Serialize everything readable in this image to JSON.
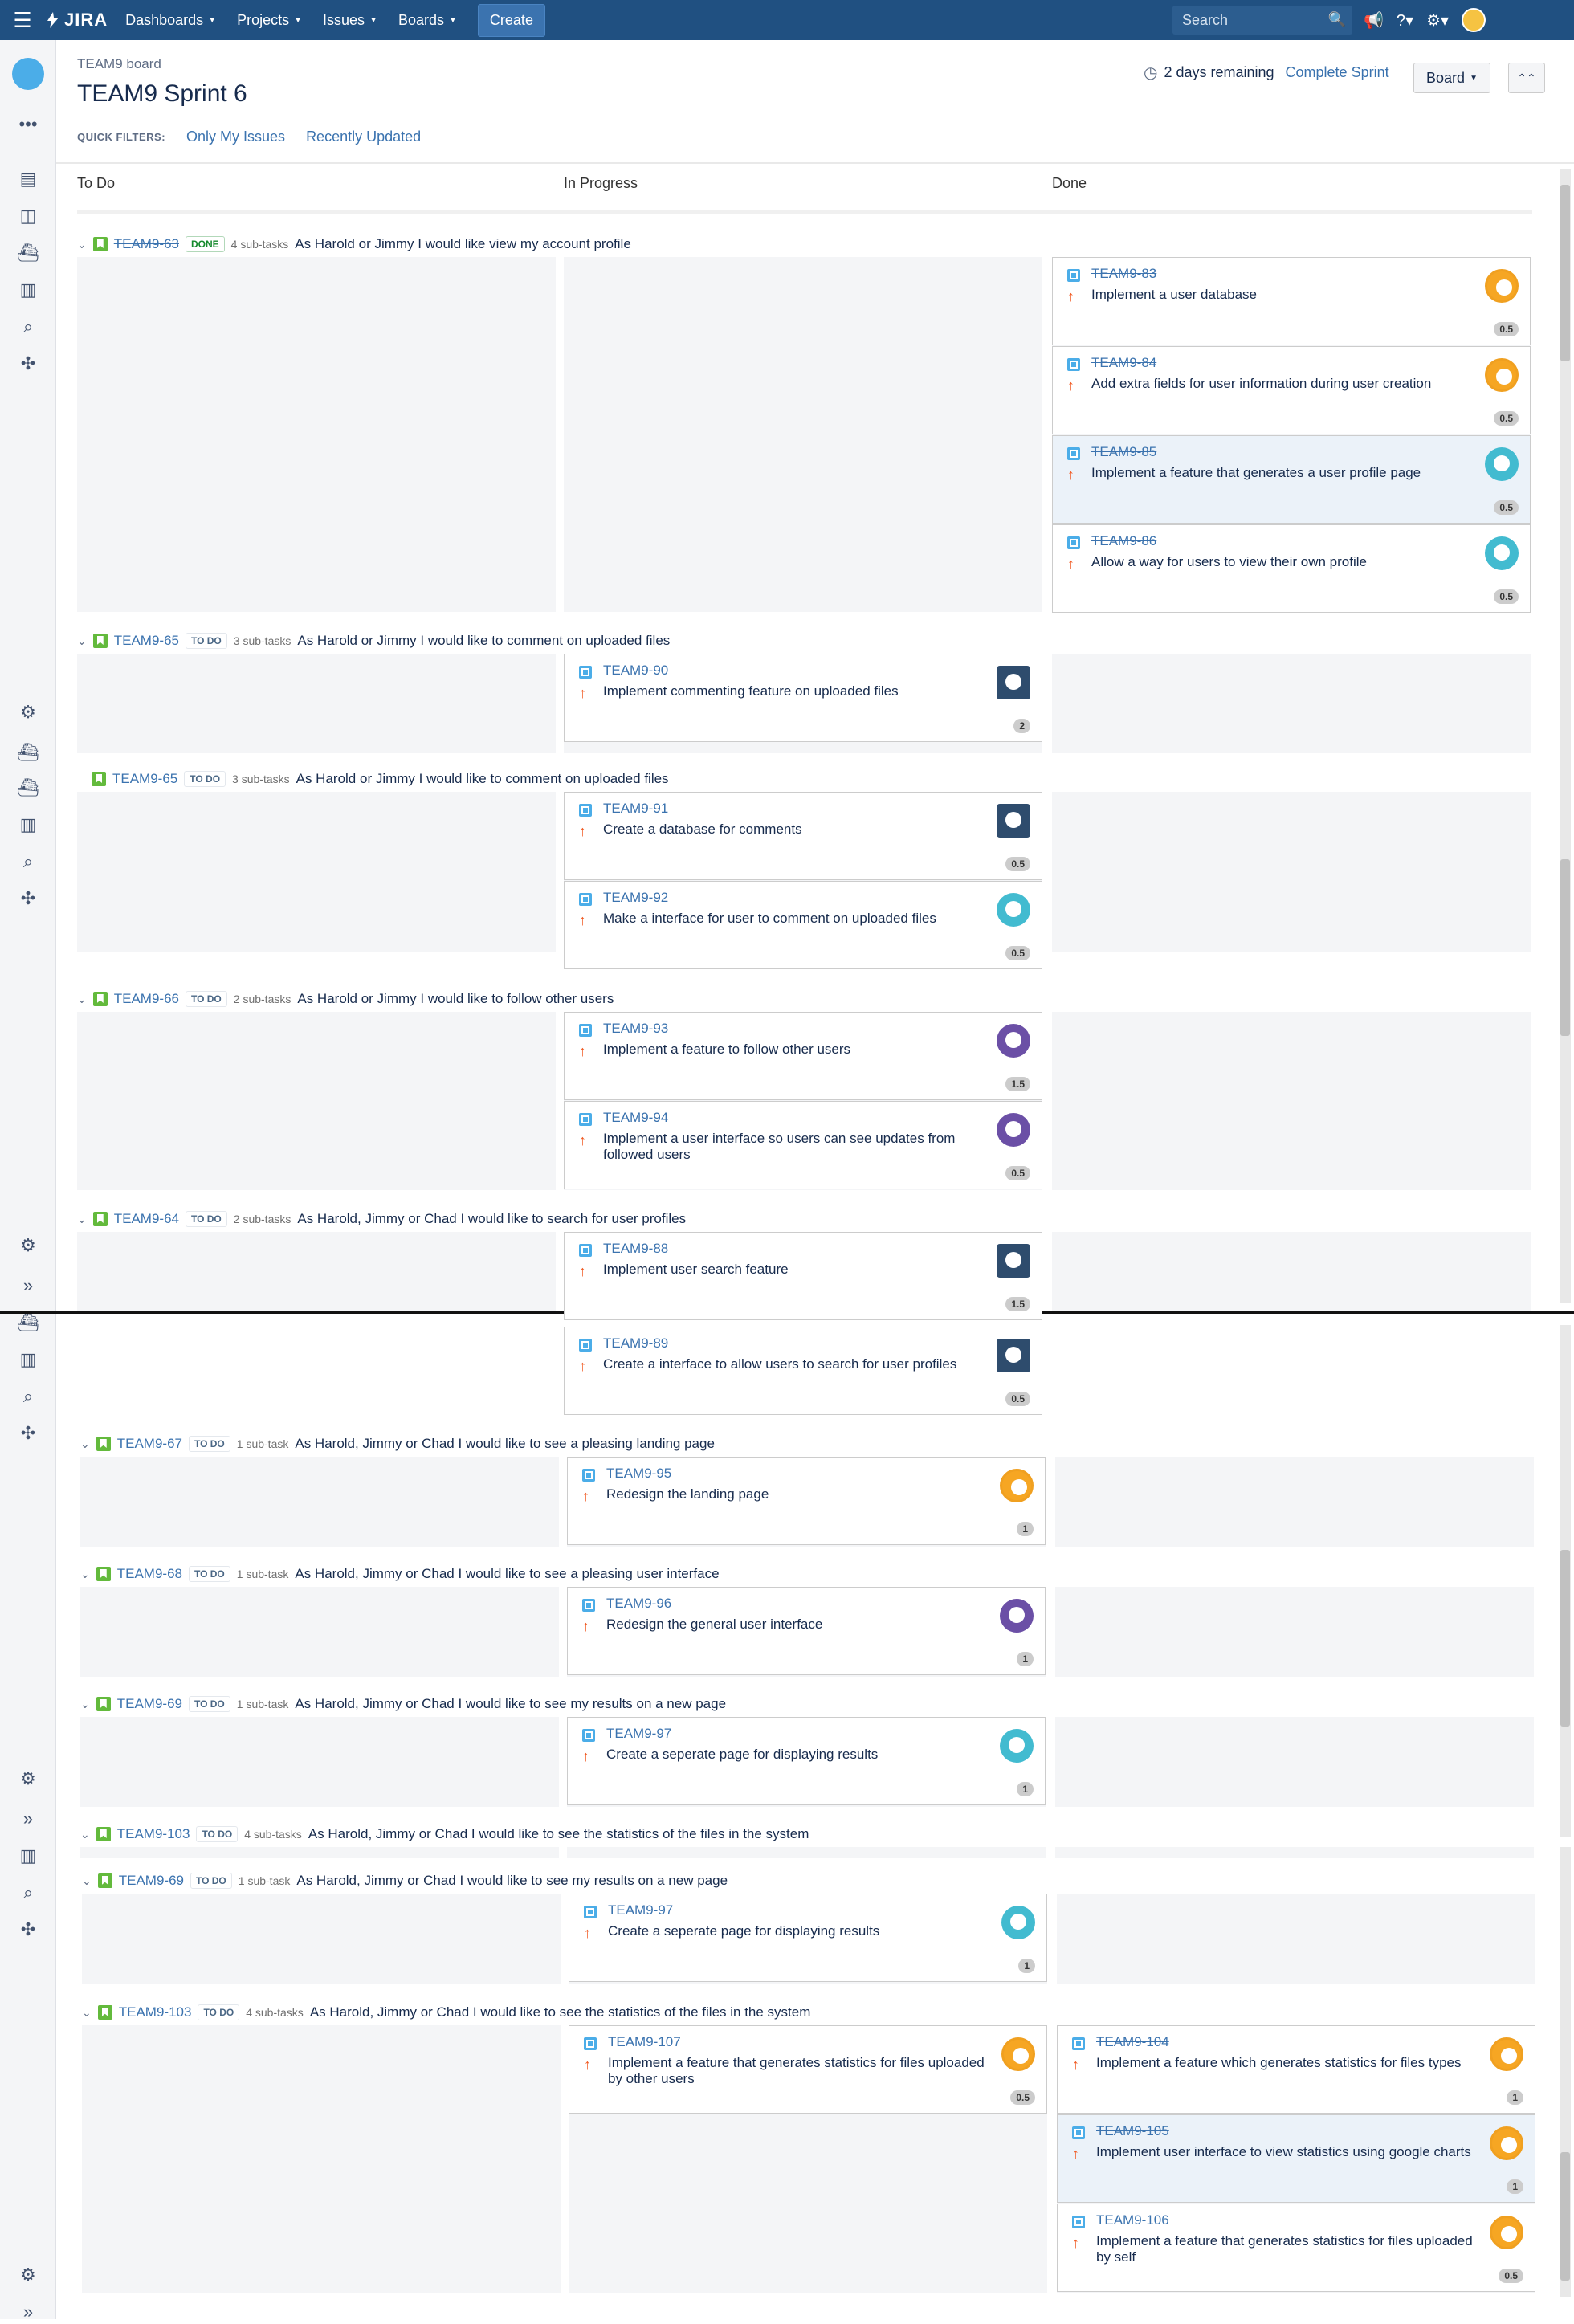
{
  "nav": {
    "items": [
      "Dashboards",
      "Projects",
      "Issues",
      "Boards"
    ],
    "create": "Create",
    "search_placeholder": "Search",
    "logo": "JIRA"
  },
  "header": {
    "board_name": "TEAM9 board",
    "sprint_name": "TEAM9 Sprint 6",
    "remaining": "2 days remaining",
    "complete": "Complete Sprint",
    "board_btn": "Board"
  },
  "quick_filters": {
    "label": "QUICK FILTERS:",
    "f1": "Only My Issues",
    "f2": "Recently Updated"
  },
  "columns": [
    "To Do",
    "In Progress",
    "Done"
  ],
  "swimlanes": [
    {
      "key": "TEAM9-63",
      "status": "DONE",
      "subtasks": "4 sub-tasks",
      "summary": "As Harold or Jimmy I would like view my account profile"
    },
    {
      "key": "TEAM9-65",
      "status": "TO DO",
      "subtasks": "3 sub-tasks",
      "summary": "As Harold or Jimmy I would like to comment on uploaded files"
    },
    {
      "key": "TEAM9-65",
      "status": "TO DO",
      "subtasks": "3 sub-tasks",
      "summary": "As Harold or Jimmy I would like to comment on uploaded files"
    },
    {
      "key": "TEAM9-66",
      "status": "TO DO",
      "subtasks": "2 sub-tasks",
      "summary": "As Harold or Jimmy I would like to follow other users"
    },
    {
      "key": "TEAM9-64",
      "status": "TO DO",
      "subtasks": "2 sub-tasks",
      "summary": "As Harold, Jimmy or Chad I would like to search for user profiles"
    },
    {
      "key": "TEAM9-67",
      "status": "TO DO",
      "subtasks": "1 sub-task",
      "summary": "As Harold, Jimmy or Chad I would like to see a pleasing landing page"
    },
    {
      "key": "TEAM9-68",
      "status": "TO DO",
      "subtasks": "1 sub-task",
      "summary": "As Harold, Jimmy or Chad I would like to see a pleasing user interface"
    },
    {
      "key": "TEAM9-69",
      "status": "TO DO",
      "subtasks": "1 sub-task",
      "summary": "As Harold, Jimmy or Chad I would like to see my results on a new page"
    },
    {
      "key": "TEAM9-103",
      "status": "TO DO",
      "subtasks": "4 sub-tasks",
      "summary": "As Harold, Jimmy or Chad I would like to see the statistics of the files in the system"
    },
    {
      "key": "TEAM9-69",
      "status": "TO DO",
      "subtasks": "1 sub-task",
      "summary": "As Harold, Jimmy or Chad I would like to see my results on a new page"
    },
    {
      "key": "TEAM9-103",
      "status": "TO DO",
      "subtasks": "4 sub-tasks",
      "summary": "As Harold, Jimmy or Chad I would like to see the statistics of the files in the system"
    }
  ],
  "cards": [
    {
      "key": "TEAM9-83",
      "summary": "Implement a user database",
      "est": "0.5",
      "done": true
    },
    {
      "key": "TEAM9-84",
      "summary": "Add extra fields for user information during user creation",
      "est": "0.5",
      "done": true
    },
    {
      "key": "TEAM9-85",
      "summary": "Implement a feature that generates a user profile page",
      "est": "0.5",
      "done": true
    },
    {
      "key": "TEAM9-86",
      "summary": "Allow a way for users to view their own profile",
      "est": "0.5",
      "done": true
    },
    {
      "key": "TEAM9-90",
      "summary": "Implement commenting feature on uploaded files",
      "est": "2"
    },
    {
      "key": "TEAM9-91",
      "summary": "Create a database for comments",
      "est": "0.5"
    },
    {
      "key": "TEAM9-92",
      "summary": "Make a interface for user to comment on uploaded files",
      "est": "0.5"
    },
    {
      "key": "TEAM9-93",
      "summary": "Implement a feature to follow other users",
      "est": "1.5"
    },
    {
      "key": "TEAM9-94",
      "summary": "Implement a user interface so users can see updates from followed users",
      "est": "0.5"
    },
    {
      "key": "TEAM9-88",
      "summary": "Implement user search feature",
      "est": "1.5"
    },
    {
      "key": "TEAM9-89",
      "summary": "Create a interface to allow users to search for user profiles",
      "est": "0.5"
    },
    {
      "key": "TEAM9-95",
      "summary": "Redesign the landing page",
      "est": "1"
    },
    {
      "key": "TEAM9-96",
      "summary": "Redesign the general user interface",
      "est": "1"
    },
    {
      "key": "TEAM9-97",
      "summary": "Create a seperate page for displaying results",
      "est": "1"
    },
    {
      "key": "TEAM9-97",
      "summary": "Create a seperate page for displaying results",
      "est": "1"
    },
    {
      "key": "TEAM9-107",
      "summary": "Implement a feature that generates statistics for files uploaded by other users",
      "est": "0.5"
    },
    {
      "key": "TEAM9-104",
      "summary": "Implement a feature which generates statistics for files types",
      "est": "1",
      "done": true
    },
    {
      "key": "TEAM9-105",
      "summary": "Implement user interface to view statistics using google charts",
      "est": "1",
      "done": true
    },
    {
      "key": "TEAM9-106",
      "summary": "Implement a feature that generates statistics for files uploaded by self",
      "est": "0.5",
      "done": true
    }
  ]
}
